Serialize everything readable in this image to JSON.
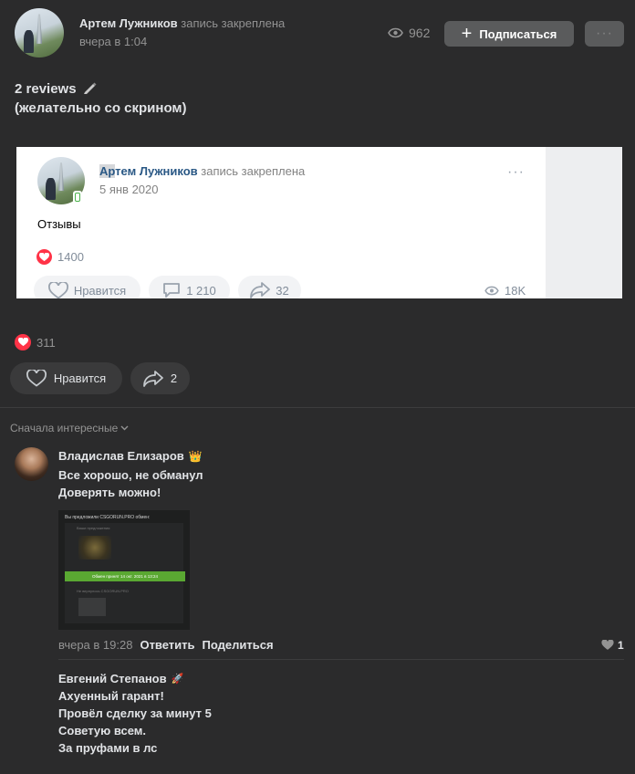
{
  "post": {
    "author": "Артем Лужников",
    "status": "запись закреплена",
    "time": "вчера в 1:04",
    "views": "962",
    "subscribe_label": "Подписаться",
    "more_label": "···",
    "text_line1": "2 reviews",
    "text_line2": "(желательно со скрином)",
    "likes": "311",
    "like_label": "Нравится",
    "share_count": "2"
  },
  "embedded": {
    "author_short": "Ар",
    "author_rest": "тем Лужников",
    "status": "запись закреплена",
    "date": "5 янв 2020",
    "text": "Отзывы",
    "likes": "1400",
    "like_label": "Нравится",
    "comments": "1 210",
    "shares": "32",
    "views": "18K",
    "more_label": "···"
  },
  "comments_sort": "Сначала интересные",
  "comments": [
    {
      "name": "Владислав Елизаров",
      "badge": "👑",
      "lines": [
        "Все хорошо, не обманул",
        "Доверять можно!"
      ],
      "time": "вчера в 19:28",
      "reply": "Ответить",
      "share": "Поделиться",
      "likes": "1",
      "screenshot": {
        "title": "Вы предложили CSGORUN.PRO обмен:",
        "sub1": "Ваши предложения",
        "banner": "Обмен принят 14 окт. 2021 в 13:24",
        "sub2": "Не вернулось CSGORUN.PRO"
      }
    },
    {
      "name": "Евгений Степанов",
      "badge": "🚀",
      "lines": [
        "Ахуенный гарант!",
        "Провёл сделку за минут 5",
        "Советую всем.",
        "За пруфами в лс"
      ]
    }
  ],
  "colors": {
    "accent_red": "#ff3347",
    "bg": "#2b2b2c",
    "green_banner": "#5aa832"
  }
}
